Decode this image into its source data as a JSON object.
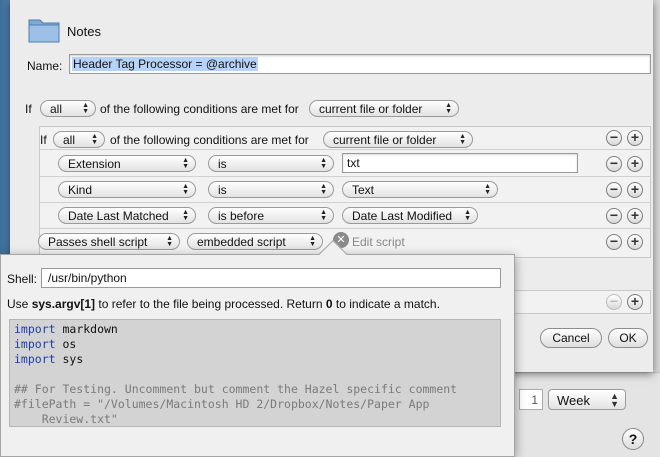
{
  "sheet": {
    "title": "Notes",
    "name_label": "Name:",
    "name_value": "Header Tag Processor = @archive"
  },
  "outer_rule": {
    "if_label": "If",
    "match": "all",
    "middle_text": "of the following conditions are met for",
    "target": "current file or folder"
  },
  "inner_rule": {
    "if_label": "If",
    "match": "all",
    "middle_text": "of the following conditions are met for",
    "target": "current file or folder"
  },
  "conditions": [
    {
      "attribute": "Extension",
      "operator": "is",
      "value": "txt"
    },
    {
      "attribute": "Kind",
      "operator": "is",
      "value": "Text"
    },
    {
      "attribute": "Date Last Matched",
      "operator": "is before",
      "value": "Date Last Modified"
    },
    {
      "attribute": "Passes shell script",
      "operator": "embedded script",
      "value": "Edit script"
    }
  ],
  "buttons": {
    "cancel": "Cancel",
    "ok": "OK",
    "remove": "−",
    "add": "+",
    "help": "?"
  },
  "background": {
    "number_value": "1",
    "period_select": "Week"
  },
  "script_popover": {
    "shell_label": "Shell:",
    "shell_value": "/usr/bin/python",
    "hint_prefix": "Use ",
    "hint_arg": "sys.argv[1]",
    "hint_mid": " to refer to the file being processed. Return ",
    "hint_zero": "0",
    "hint_suffix": " to indicate a match.",
    "code_lines": [
      {
        "kw": "import",
        "rest": " markdown"
      },
      {
        "kw": "import",
        "rest": " os"
      },
      {
        "kw": "import",
        "rest": " sys"
      },
      {
        "kw": "",
        "rest": ""
      },
      {
        "comment": "## For Testing. Uncomment but comment the Hazel specific comment"
      },
      {
        "comment": "#filePath = \"/Volumes/Macintosh HD 2/Dropbox/Notes/Paper App"
      },
      {
        "comment": "    Review.txt\""
      }
    ]
  },
  "colors": {
    "selection": "#b6d4fb",
    "keyword": "#1f3ea6",
    "comment": "#7a7a7a"
  }
}
